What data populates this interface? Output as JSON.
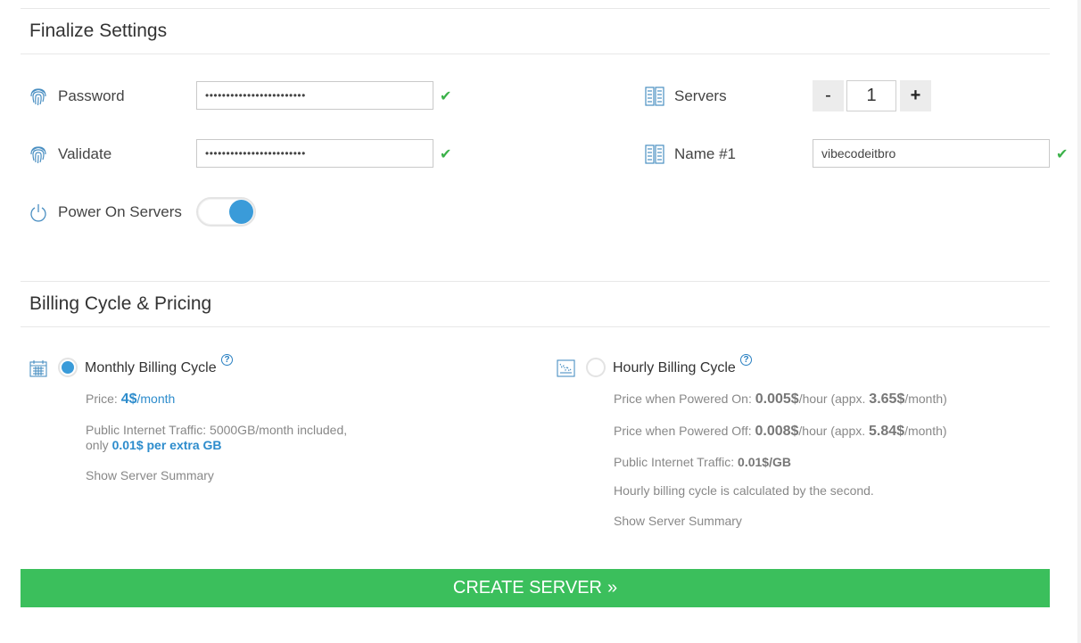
{
  "finalize": {
    "title": "Finalize Settings",
    "password_label": "Password",
    "password_value": "••••••••••••••••••••••••",
    "validate_label": "Validate",
    "validate_value": "••••••••••••••••••••••••",
    "power_label": "Power On Servers",
    "power_on": true,
    "servers_label": "Servers",
    "servers_minus": "-",
    "servers_count": "1",
    "servers_plus": "+",
    "name_label": "Name #1",
    "name_value": "vibecodeitbro",
    "check_glyph": "✔"
  },
  "billing": {
    "title": "Billing Cycle & Pricing",
    "help_glyph": "?",
    "monthly": {
      "label": "Monthly Billing Cycle",
      "selected": true,
      "price_prefix": "Price: ",
      "price_value": "4$",
      "price_suffix": "/month",
      "traffic_line1": "Public Internet Traffic: 5000GB/month included,",
      "traffic_line2_prefix": "only ",
      "traffic_line2_value": "0.01$ per extra GB",
      "summary_link": "Show Server Summary"
    },
    "hourly": {
      "label": "Hourly Billing Cycle",
      "selected": false,
      "on_prefix": "Price when Powered On: ",
      "on_value": "0.005$",
      "on_mid": "/hour (appx. ",
      "on_month": "3.65$",
      "on_suffix": "/month)",
      "off_prefix": "Price when Powered Off: ",
      "off_value": "0.008$",
      "off_mid": "/hour (appx. ",
      "off_month": "5.84$",
      "off_suffix": "/month)",
      "traffic_prefix": "Public Internet Traffic: ",
      "traffic_value": "0.01$/GB",
      "note": "Hourly billing cycle is calculated by the second.",
      "summary_link": "Show Server Summary"
    }
  },
  "create_button": {
    "label": "CREATE SERVER",
    "arrow": "»"
  },
  "colors": {
    "accent_blue": "#3a9bd9",
    "success_green": "#3cb24a",
    "create_green": "#3bbf5c"
  },
  "icons": [
    "fingerprint-icon",
    "power-icon",
    "server-icon",
    "calendar-icon",
    "hourly-chart-icon",
    "check-icon",
    "help-icon"
  ]
}
